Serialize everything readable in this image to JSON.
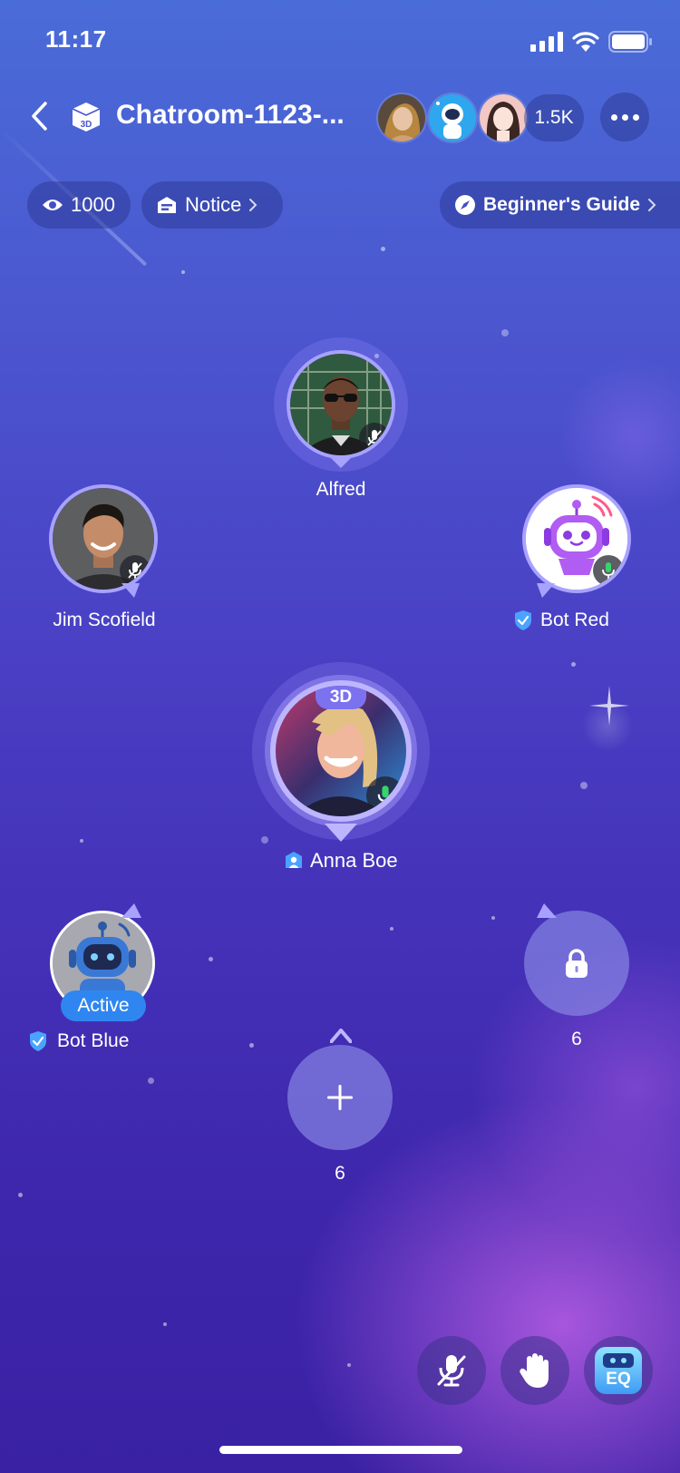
{
  "status_bar": {
    "time": "11:17"
  },
  "header": {
    "title": "Chatroom-1123-...",
    "online_count": "1.5K"
  },
  "chips": {
    "views": "1000",
    "notice": "Notice",
    "guide": "Beginner's Guide"
  },
  "seats": {
    "alfred": {
      "name": "Alfred",
      "mic": "muted"
    },
    "jim": {
      "name": "Jim Scofield",
      "mic": "muted"
    },
    "bot_red": {
      "name": "Bot Red",
      "mic": "active"
    },
    "anna": {
      "name": "Anna Boe",
      "badge": "3D",
      "mic": "active"
    },
    "bot_blue": {
      "name": "Bot Blue",
      "status": "Active"
    },
    "locked_seat": {
      "number": "6"
    },
    "empty_seat": {
      "number": "6"
    }
  },
  "bottom_bar": {
    "eq_label": "EQ"
  },
  "colors": {
    "seat_border": "#a8a2ff",
    "active_badge": "#2f86f0",
    "verified": "#4aa3ff"
  }
}
